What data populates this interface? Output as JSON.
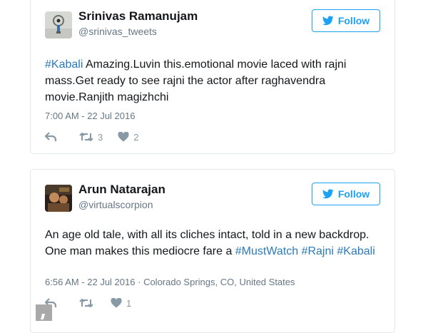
{
  "tweets": [
    {
      "name": "Srinivas Ramanujam",
      "handle": "@srinivas_tweets",
      "follow_label": "Follow",
      "text_segments": [
        {
          "text": "#Kabali",
          "type": "hashtag"
        },
        {
          "text": " Amazing.Luvin this.emotional movie laced with rajni mass.Get ready to see rajni the actor after raghavendra movie.Ranjith magizhchi",
          "type": "text"
        }
      ],
      "timestamp": "7:00 AM - 22 Jul 2016",
      "location": "",
      "retweet_count": "3",
      "like_count": "2",
      "avatar_icon": "key-ring-avatar"
    },
    {
      "name": "Arun Natarajan",
      "handle": "@virtualscorpion",
      "follow_label": "Follow",
      "text_segments": [
        {
          "text": "An age old tale, with all its cliches intact, told in a new backdrop. One man makes this mediocre fare a ",
          "type": "text"
        },
        {
          "text": "#MustWatch",
          "type": "hashtag"
        },
        {
          "text": " ",
          "type": "text"
        },
        {
          "text": "#Rajni",
          "type": "hashtag"
        },
        {
          "text": " ",
          "type": "text"
        },
        {
          "text": "#Kabali",
          "type": "hashtag"
        }
      ],
      "timestamp": "6:56 AM - 22 Jul 2016",
      "location": "Colorado Springs, CO, United States",
      "retweet_count": "",
      "like_count": "1",
      "avatar_icon": "photo-avatar"
    }
  ],
  "colors": {
    "twitter_blue": "#1da1f2",
    "hashtag_blue": "#2b7bb9",
    "muted_gray": "#657786",
    "icon_gray": "#8899a6",
    "border": "#e1e8ed"
  },
  "icons": [
    "twitter-bird-icon",
    "reply-icon",
    "retweet-icon",
    "heart-icon"
  ]
}
